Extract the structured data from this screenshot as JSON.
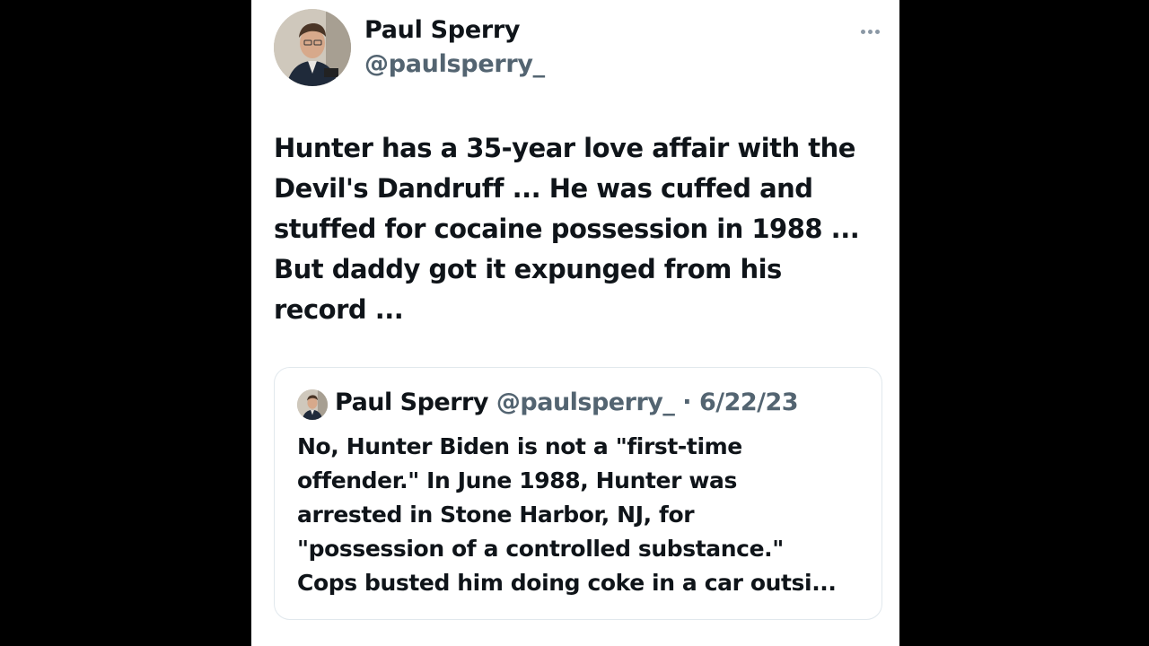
{
  "tweet": {
    "author": {
      "display_name": "Paul Sperry",
      "handle": "@paulsperry_",
      "avatar_icon": "profile-photo"
    },
    "text": "Hunter has a 35-year love affair with the\nDevil's Dandruff ... He was cuffed and\nstuffed for cocaine possession in 1988 ...\nBut daddy got it expunged from his\nrecord ...",
    "more_icon": "more-horizontal-icon"
  },
  "quote": {
    "author": {
      "display_name": "Paul Sperry",
      "handle": "@paulsperry_",
      "separator": "·",
      "date": "6/22/23"
    },
    "text": "No, Hunter Biden is not a \"first-time\noffender.\" In June 1988, Hunter was\narrested in Stone Harbor, NJ, for\n\"possession of a controlled substance.\"\nCops busted him doing coke in a car outsi..."
  },
  "colors": {
    "background": "#000000",
    "card": "#ffffff",
    "primary_text": "#0f1419",
    "secondary_text": "#536471",
    "border": "#e1e8ed"
  }
}
